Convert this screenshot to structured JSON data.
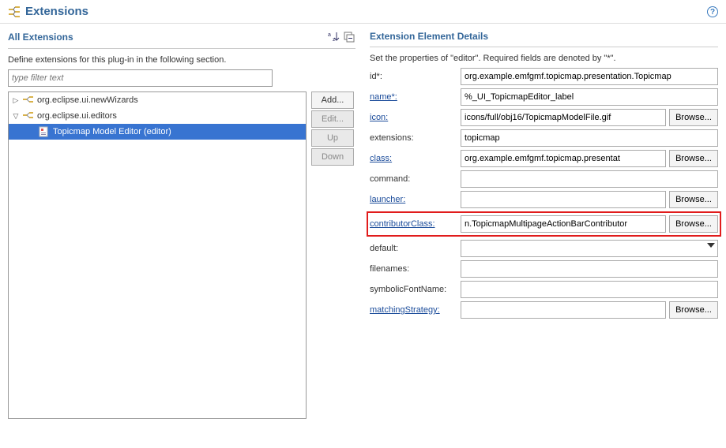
{
  "header": {
    "title": "Extensions"
  },
  "left": {
    "sectionTitle": "All Extensions",
    "desc": "Define extensions for this plug-in in the following section.",
    "filterPlaceholder": "type filter text",
    "tree": {
      "n0": "org.eclipse.ui.newWizards",
      "n1": "org.eclipse.ui.editors",
      "n2": "Topicmap Model Editor (editor)"
    },
    "buttons": {
      "add": "Add...",
      "edit": "Edit...",
      "up": "Up",
      "down": "Down"
    }
  },
  "right": {
    "sectionTitle": "Extension Element Details",
    "desc": "Set the properties of \"editor\". Required fields are denoted by \"*\".",
    "labels": {
      "id": "id*:",
      "name": "name*:",
      "icon": "icon:",
      "extensions": "extensions:",
      "class": "class:",
      "command": "command:",
      "launcher": "launcher:",
      "contributorClass": "contributorClass:",
      "default": "default:",
      "filenames": "filenames:",
      "symbolicFontName": "symbolicFontName:",
      "matchingStrategy": "matchingStrategy:"
    },
    "values": {
      "id": "org.example.emfgmf.topicmap.presentation.Topicmap",
      "name": "%_UI_TopicmapEditor_label",
      "icon": "icons/full/obj16/TopicmapModelFile.gif",
      "extensions": "topicmap",
      "class": "org.example.emfgmf.topicmap.presentat",
      "command": "",
      "launcher": "",
      "contributorClass": "n.TopicmapMultipageActionBarContributor",
      "default": "",
      "filenames": "",
      "symbolicFontName": "",
      "matchingStrategy": ""
    },
    "browse": "Browse..."
  }
}
